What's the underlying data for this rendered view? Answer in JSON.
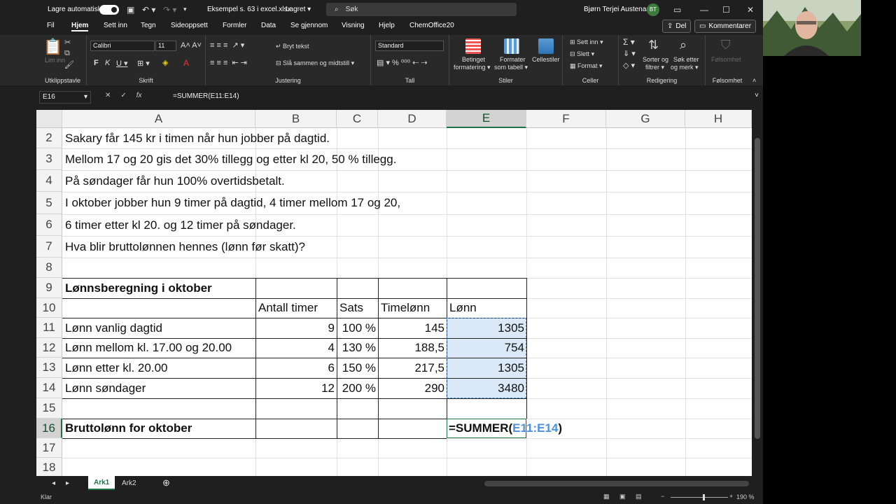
{
  "titlebar": {
    "autosave_label": "Lagre automatisk",
    "filename": "Eksempel s. 63 i excel.xlsx",
    "saved_status": "Lagret",
    "search_placeholder": "Søk",
    "username": "Bjørn Terjei Austenaa",
    "initials": "BT"
  },
  "tabs": [
    "Fil",
    "Hjem",
    "Sett inn",
    "Tegn",
    "Sideoppsett",
    "Formler",
    "Data",
    "Se gjennom",
    "Visning",
    "Hjelp",
    "ChemOffice20"
  ],
  "share": {
    "share_label": "Del",
    "comments_label": "Kommentarer"
  },
  "ribbon": {
    "clipboard": {
      "label": "Utklippstavle",
      "paste": "Lim inn"
    },
    "font": {
      "label": "Skrift",
      "name": "Calibri",
      "size": "11"
    },
    "alignment": {
      "label": "Justering",
      "wrap": "Bryt tekst",
      "merge": "Slå sammen og midtstill"
    },
    "number": {
      "label": "Tall",
      "format": "Standard"
    },
    "styles": {
      "label": "Stiler",
      "cond1": "Betinget",
      "cond2": "formatering",
      "table1": "Formater",
      "table2": "som tabell",
      "cell": "Cellestiler"
    },
    "cells": {
      "label": "Celler",
      "insert": "Sett inn",
      "delete": "Slett",
      "format": "Format"
    },
    "editing": {
      "label": "Redigering",
      "sort1": "Sorter og",
      "sort2": "filtrer",
      "find1": "Søk etter",
      "find2": "og merk"
    },
    "sensitivity": {
      "label": "Følsomhet",
      "btn": "Følsomhet"
    }
  },
  "formula_bar": {
    "name_box": "E16",
    "formula": "=SUMMER(E11:E14)"
  },
  "columns": [
    "A",
    "B",
    "C",
    "D",
    "E",
    "F",
    "G",
    "H"
  ],
  "rows": [
    "2",
    "3",
    "4",
    "5",
    "6",
    "7",
    "8",
    "9",
    "10",
    "11",
    "12",
    "13",
    "14",
    "15",
    "16",
    "17",
    "18"
  ],
  "text_rows": {
    "r2": "Sakary får 145 kr i timen når hun jobber på dagtid.",
    "r3": "Mellom 17 og 20 gis det 30% tillegg og etter kl 20, 50 % tillegg.",
    "r4": "På søndager får hun 100% overtidsbetalt.",
    "r5": "I oktober jobber hun 9 timer på dagtid, 4 timer mellom 17 og 20,",
    "r6": "6 timer etter kl 20. og 12 timer på søndager.",
    "r7": "Hva blir bruttolønnen hennes (lønn før skatt)?"
  },
  "table": {
    "title": "Lønnsberegning i oktober",
    "headers": [
      "Antall timer",
      "Sats",
      "Timelønn",
      "Lønn"
    ],
    "rows": [
      {
        "label": "Lønn vanlig dagtid",
        "hours": "9",
        "rate": "100 %",
        "wage": "145",
        "pay": "1305"
      },
      {
        "label": "Lønn mellom kl. 17.00 og 20.00",
        "hours": "4",
        "rate": "130 %",
        "wage": "188,5",
        "pay": "754"
      },
      {
        "label": "Lønn etter kl. 20.00",
        "hours": "6",
        "rate": "150 %",
        "wage": "217,5",
        "pay": "1305"
      },
      {
        "label": "Lønn søndager",
        "hours": "12",
        "rate": "200 %",
        "wage": "290",
        "pay": "3480"
      }
    ],
    "total_label": "Bruttolønn for oktober",
    "edit_prefix": "=SUMMER(",
    "edit_ref": "E11:E14",
    "edit_suffix": ")"
  },
  "sheets": [
    "Ark1",
    "Ark2"
  ],
  "status": {
    "mode": "Klar",
    "zoom": "190 %"
  },
  "colors": {
    "accent": "#217346",
    "selection": "#dbe8f7",
    "ref_blue": "#4a90e2"
  }
}
